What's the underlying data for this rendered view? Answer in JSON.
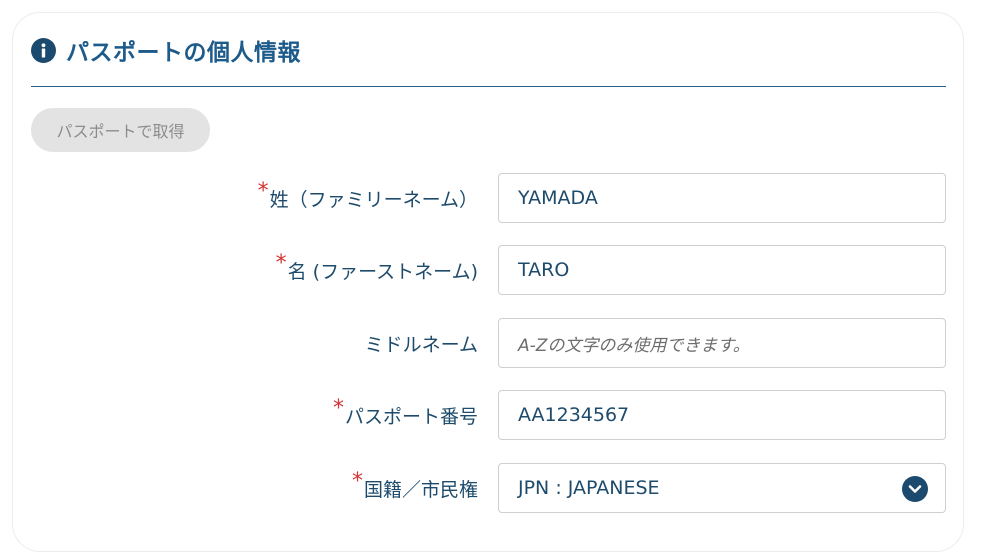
{
  "section": {
    "title": "パスポートの個人情報",
    "info_icon": "info-circle-icon"
  },
  "passport_button": {
    "label": "パスポートで取得"
  },
  "fields": [
    {
      "label": "姓（ファミリーネーム）",
      "required": true,
      "value": "YAMADA",
      "placeholder": ""
    },
    {
      "label": "名 (ファーストネーム)",
      "required": true,
      "value": "TARO",
      "placeholder": ""
    },
    {
      "label": "ミドルネーム",
      "required": false,
      "value": "",
      "placeholder": "A-Zの文字のみ使用できます。"
    },
    {
      "label": "パスポート番号",
      "required": true,
      "value": "AA1234567",
      "placeholder": ""
    },
    {
      "label": "国籍／市民権",
      "required": true,
      "value": "JPN : JAPANESE",
      "placeholder": "",
      "type": "select"
    }
  ],
  "required_mark": "*",
  "colors": {
    "accent": "#1d5b8a",
    "icon_bg": "#1c4a6e",
    "required": "#d23333",
    "button_bg": "#e3e3e3"
  }
}
